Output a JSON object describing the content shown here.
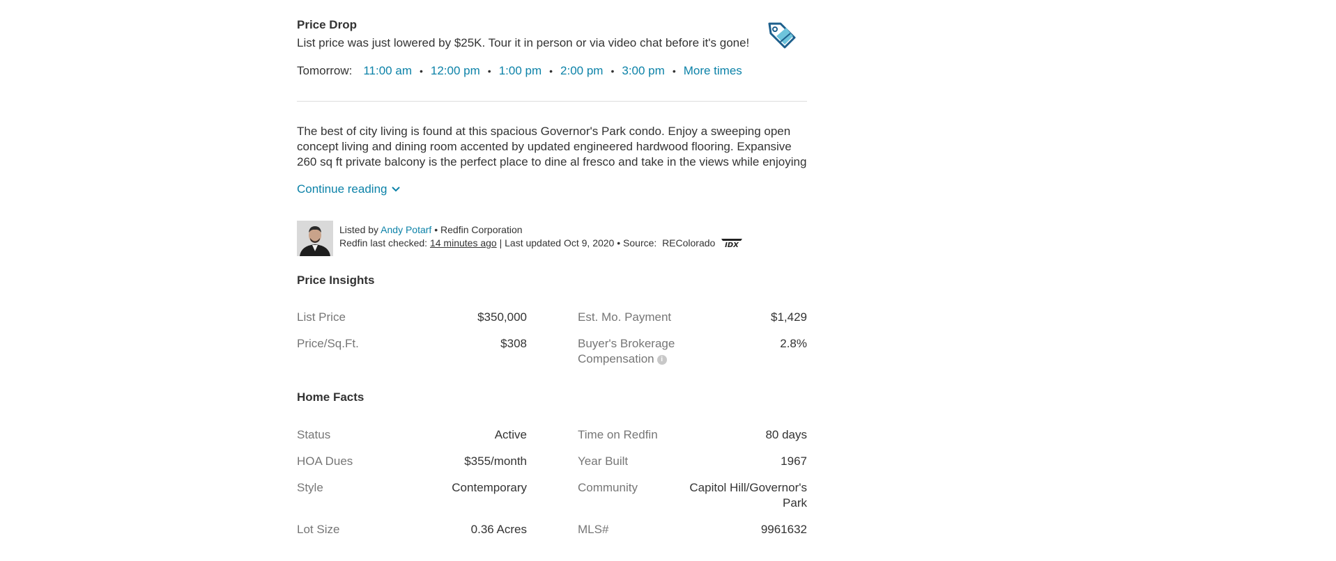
{
  "price_drop": {
    "title": "Price Drop",
    "text": "List price was just lowered by $25K. Tour it in person or via video chat before it's gone!",
    "icon": "price-tag-icon",
    "tour_label": "Tomorrow:",
    "times": [
      "11:00 am",
      "12:00 pm",
      "1:00 pm",
      "2:00 pm",
      "3:00 pm"
    ],
    "more_times": "More times",
    "colors": {
      "link": "#0c82a8",
      "tag": "#1d5f8c",
      "tag_fill": "#6ec4dc"
    }
  },
  "remarks": {
    "text": "The best of city living is found at this spacious Governor's Park condo. Enjoy a sweeping open concept living and dining room accented by updated engineered hardwood flooring. Expansive 260 sq ft private balcony is the perfect place to dine al fresco and take in the views while enjoying",
    "continue_label": "Continue reading"
  },
  "listing": {
    "listed_by_prefix": "Listed by",
    "agent_name": "Andy Potarf",
    "brokerage": "Redfin Corporation",
    "checked_prefix": "Redfin last checked:",
    "checked_value": "14 minutes ago",
    "updated": "| Last updated Oct 9, 2020 • Source:",
    "source": "REColorado",
    "source_logo": "IDX"
  },
  "price_insights": {
    "title": "Price Insights",
    "left": [
      {
        "label": "List Price",
        "value": "$350,000"
      },
      {
        "label": "Price/Sq.Ft.",
        "value": "$308"
      }
    ],
    "right": [
      {
        "label": "Est. Mo. Payment",
        "value": "$1,429"
      },
      {
        "label": "Buyer's Brokerage Compensation",
        "value": "2.8%"
      }
    ],
    "info_icon": "info-icon"
  },
  "home_facts": {
    "title": "Home Facts",
    "left": [
      {
        "label": "Status",
        "value": "Active"
      },
      {
        "label": "HOA Dues",
        "value": "$355/month"
      },
      {
        "label": "Style",
        "value": "Contemporary"
      },
      {
        "label": "Lot Size",
        "value": "0.36 Acres"
      }
    ],
    "right": [
      {
        "label": "Time on Redfin",
        "value": "80 days"
      },
      {
        "label": "Year Built",
        "value": "1967"
      },
      {
        "label": "Community",
        "value": "Capitol Hill/Governor's Park"
      },
      {
        "label": "MLS#",
        "value": "9961632"
      }
    ]
  }
}
